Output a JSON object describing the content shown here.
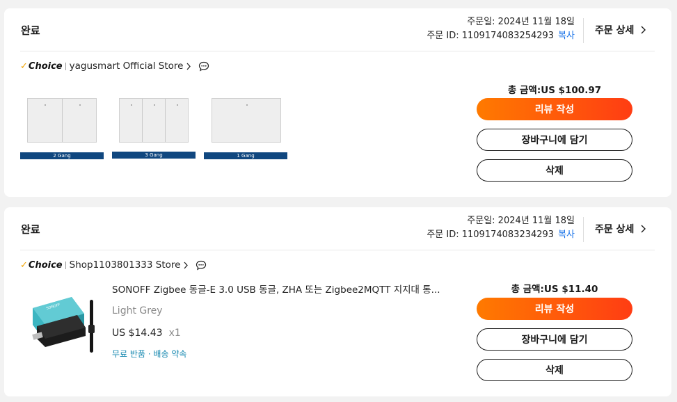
{
  "orders": [
    {
      "status": "완료",
      "order_date": "주문일: 2024년 11월 18일",
      "order_id": "주문 ID: 1109174083254293",
      "copy_label": "복사",
      "detail_label": "주문 상세",
      "choice_label": "Choice",
      "store_name": "yagusmart Official Store",
      "gang_labels": [
        "2 Gang",
        "3 Gang",
        "1 Gang"
      ],
      "total": "총 금액:US $100.97",
      "review_label": "리뷰 작성",
      "cart_label": "장바구니에 담기",
      "delete_label": "삭제"
    },
    {
      "status": "완료",
      "order_date": "주문일: 2024년 11월 18일",
      "order_id": "주문 ID: 1109174083234293",
      "copy_label": "복사",
      "detail_label": "주문 상세",
      "choice_label": "Choice",
      "store_name": "Shop1103801333 Store",
      "product_title": "SONOFF Zigbee 동글-E 3.0 USB 동글, ZHA 또는 Zigbee2MQTT 지지대 통...",
      "product_variant": "Light Grey",
      "product_price": "US $14.43",
      "product_qty": "x1",
      "product_badge": "무료 반품 · 배송 약속",
      "total": "총 금액:US $11.40",
      "review_label": "리뷰 작성",
      "cart_label": "장바구니에 담기",
      "delete_label": "삭제"
    }
  ],
  "colors": {
    "accent_start": "#ff7a00",
    "accent_end": "#ff3d13",
    "link": "#1a73e8",
    "badge": "#1688b0",
    "gang_label_bg": "#10477f",
    "choice_check": "#f2a300"
  }
}
